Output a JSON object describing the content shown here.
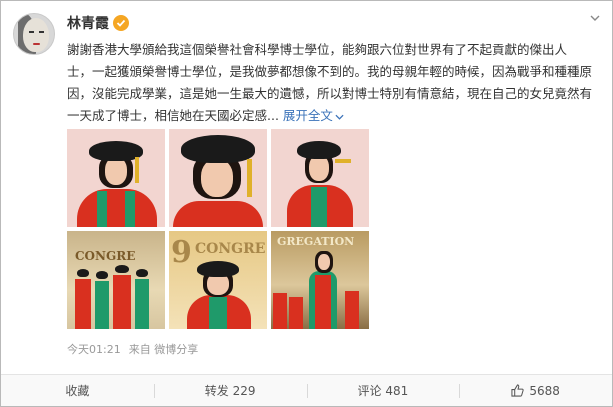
{
  "author": {
    "name": "林青霞",
    "verified": true
  },
  "post": {
    "lines": [
      "謝謝香港大學頒給我這個榮譽社會科學博士學位，能夠跟六位對世界有了不起貢獻的傑出人",
      "士，一起獲頒榮譽博士學位，是我做夢都想像不到的。我的母親年輕的時候，因為戰爭和種種原",
      "因，沒能完成學業，這是她一生最大的遺憾，所以對博士特別有情意結，現在自己的女兒竟然有",
      "一天成了博士，相信她在天國必定感"
    ],
    "expand_label": "展开全文",
    "expand_icon": "chevron-down-icon"
  },
  "photos": {
    "stage_text_1": "CONGRE",
    "stage_text_2": "9",
    "stage_text_3": "CONGRE",
    "hall_text": "GREGATION"
  },
  "meta": {
    "time": "今天01:21",
    "source": "来自 微博分享"
  },
  "footer": {
    "favorite_label": "收藏",
    "repost_label": "转发 229",
    "comment_label": "评论 481",
    "like_count": "5688"
  },
  "colors": {
    "accent_link": "#3b73b9",
    "verified_badge": "#f5a623",
    "robe_red": "#d9301f",
    "robe_green": "#1f9a6a"
  }
}
